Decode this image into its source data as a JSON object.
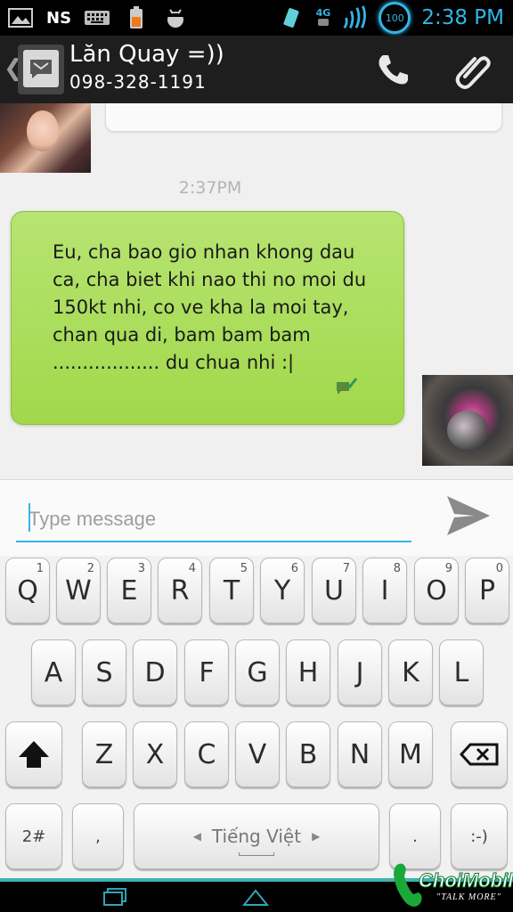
{
  "status_bar": {
    "carrier": "NS",
    "network": "4G",
    "battery_label": "100",
    "time": "2:38 PM"
  },
  "action_bar": {
    "back_glyph": "❮",
    "contact_name": "Lăn Quay =))",
    "contact_phone": "098-328-1191"
  },
  "conversation": {
    "timestamp": "2:37PM",
    "outgoing_message": "Eu, cha bao gio nhan khong dau ca, cha biet khi nao thi no moi du 150kt nhi, co ve kha la moi tay, chan qua di, bam bam bam .................. du chua nhi :|"
  },
  "compose": {
    "placeholder": "Type message"
  },
  "keyboard": {
    "row1": [
      {
        "label": "Q",
        "hint": "1"
      },
      {
        "label": "W",
        "hint": "2"
      },
      {
        "label": "E",
        "hint": "3"
      },
      {
        "label": "R",
        "hint": "4"
      },
      {
        "label": "T",
        "hint": "5"
      },
      {
        "label": "Y",
        "hint": "6"
      },
      {
        "label": "U",
        "hint": "7"
      },
      {
        "label": "I",
        "hint": "8"
      },
      {
        "label": "O",
        "hint": "9"
      },
      {
        "label": "P",
        "hint": "0"
      }
    ],
    "row2": [
      "A",
      "S",
      "D",
      "F",
      "G",
      "H",
      "J",
      "K",
      "L"
    ],
    "row3": [
      "Z",
      "X",
      "C",
      "V",
      "B",
      "N",
      "M"
    ],
    "symbols_label": "2#",
    "comma_label": ",",
    "space_label": "Tiếng Việt",
    "period_label": ".",
    "smiley_label": ":-)"
  },
  "branding": {
    "name": "ChoiMobile",
    "tagline": "\"TALK MORE\""
  },
  "colors": {
    "accent": "#33b5e5",
    "bubble_green": "#a1d84a",
    "teal_strip": "#3fb2b2"
  }
}
